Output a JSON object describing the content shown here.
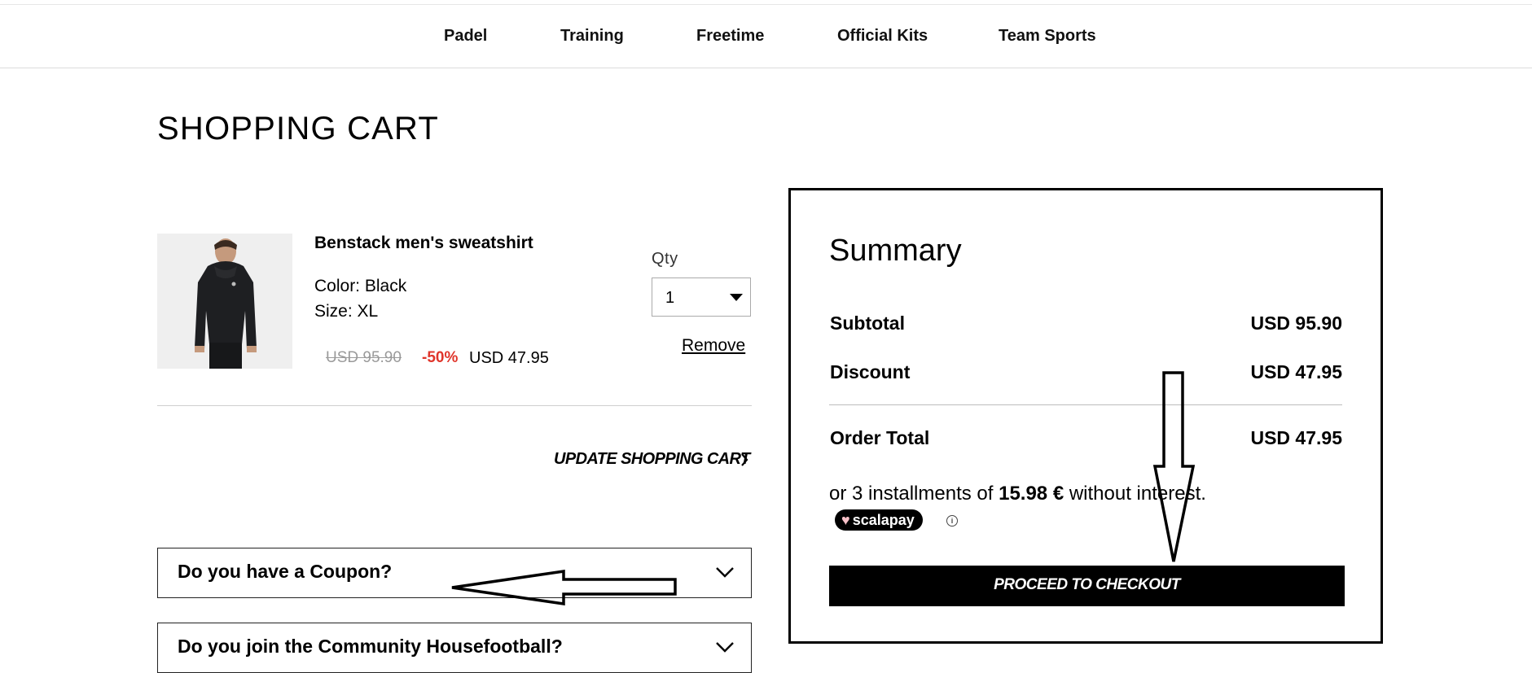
{
  "nav": {
    "items": [
      {
        "label": "Padel"
      },
      {
        "label": "Training"
      },
      {
        "label": "Freetime"
      },
      {
        "label": "Official Kits"
      },
      {
        "label": "Team Sports"
      }
    ]
  },
  "page": {
    "title": "SHOPPING CART"
  },
  "cart": {
    "item": {
      "name": "Benstack men's sweatshirt",
      "color": "Color: Black",
      "size": "Size: XL",
      "original_price": "USD 95.90",
      "discount_pct": "-50%",
      "price": "USD 47.95",
      "image_icon": "hoodie-product-photo"
    },
    "qty_label": "Qty",
    "qty_value": "1",
    "remove_label": "Remove",
    "update_label": "UPDATE SHOPPING CART"
  },
  "accordions": [
    {
      "label": "Do you have a Coupon?"
    },
    {
      "label": "Do you join the Community Housefootball?"
    }
  ],
  "summary": {
    "title": "Summary",
    "subtotal_label": "Subtotal",
    "subtotal_value": "USD 95.90",
    "discount_label": "Discount",
    "discount_value": "USD 47.95",
    "total_label": "Order Total",
    "total_value": "USD 47.95",
    "installments_prefix": "or 3 installments of ",
    "installments_amount": "15.98 €",
    "installments_suffix": " without interest.",
    "scalapay_label": "scalapay",
    "info_glyph": "i",
    "checkout_label": "PROCEED TO CHECKOUT"
  },
  "colors": {
    "discount_red": "#e0352b",
    "button_black": "#000000"
  }
}
